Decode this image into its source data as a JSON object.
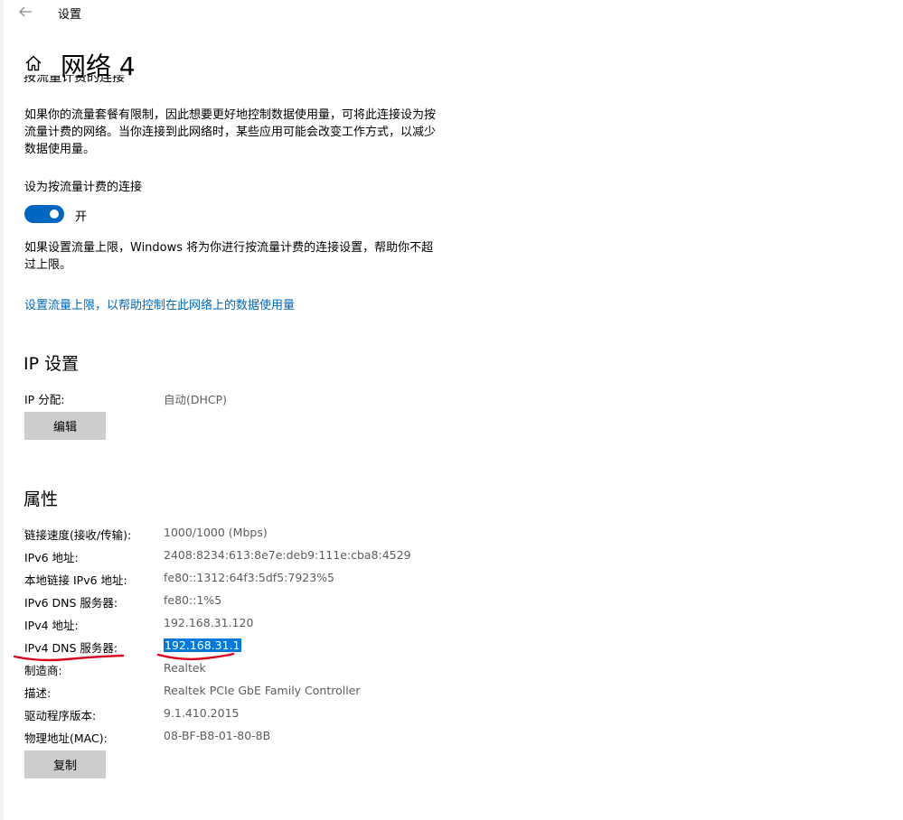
{
  "window": {
    "title": "设置"
  },
  "page": {
    "title": "网络 4"
  },
  "metered": {
    "cut_heading": "按流量计费的连接",
    "description": "如果你的流量套餐有限制，因此想要更好地控制数据使用量，可将此连接设为按流量计费的网络。当你连接到此网络时，某些应用可能会改变工作方式，以减少数据使用量。",
    "toggle_label": "设为按流量计费的连接",
    "toggle_state": "开",
    "toggle_on": true,
    "limit_note": "如果设置流量上限，Windows 将为你进行按流量计费的连接设置，帮助你不超过上限。",
    "limit_link": "设置流量上限，以帮助控制在此网络上的数据使用量"
  },
  "ip_settings": {
    "title": "IP 设置",
    "assignment_label": "IP 分配:",
    "assignment_value": "自动(DHCP)",
    "edit_button": "编辑"
  },
  "properties": {
    "title": "属性",
    "rows": [
      {
        "label": "链接速度(接收/传输):",
        "value": "1000/1000 (Mbps)"
      },
      {
        "label": "IPv6 地址:",
        "value": "2408:8234:613:8e7e:deb9:111e:cba8:4529"
      },
      {
        "label": "本地链接 IPv6 地址:",
        "value": "fe80::1312:64f3:5df5:7923%5"
      },
      {
        "label": "IPv6 DNS 服务器:",
        "value": "fe80::1%5"
      },
      {
        "label": "IPv4 地址:",
        "value": "192.168.31.120"
      },
      {
        "label": "IPv4 DNS 服务器:",
        "value": "192.168.31.1"
      },
      {
        "label": "制造商:",
        "value": "Realtek"
      },
      {
        "label": "描述:",
        "value": "Realtek PCIe GbE Family Controller"
      },
      {
        "label": "驱动程序版本:",
        "value": "9.1.410.2015"
      },
      {
        "label": "物理地址(MAC):",
        "value": "08-BF-B8-01-80-8B"
      }
    ],
    "copy_button": "复制"
  },
  "colors": {
    "accent": "#0067c0",
    "link": "#0067b8",
    "selection": "#0078d7",
    "annotation_red": "#d9001b",
    "button_gray": "#cccccc"
  },
  "icons": {
    "back": "arrow-left-icon",
    "home": "home-icon"
  }
}
